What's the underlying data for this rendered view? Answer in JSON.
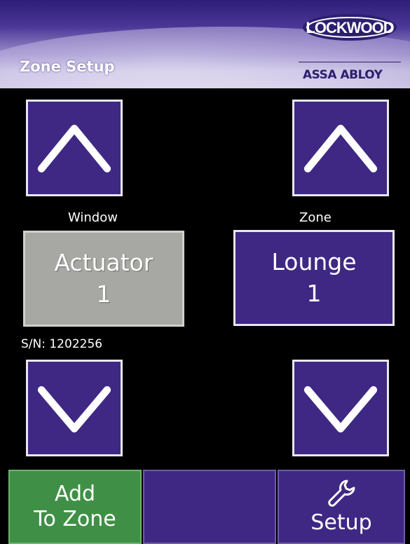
{
  "header": {
    "title": "Zone Setup",
    "brand": "LOCKWOOD",
    "brand_sub": "ASSA ABLOY"
  },
  "window_selector": {
    "label": "Window",
    "value_name": "Actuator",
    "value_number": "1",
    "serial": "S/N: 1202256"
  },
  "zone_selector": {
    "label": "Zone",
    "value_name": "Lounge",
    "value_number": "1"
  },
  "footer": {
    "add_line1": "Add",
    "add_line2": "To Zone",
    "setup_label": "Setup"
  },
  "colors": {
    "purple": "#3e2883",
    "green": "#3f9046",
    "grey": "#a7a7a3"
  }
}
